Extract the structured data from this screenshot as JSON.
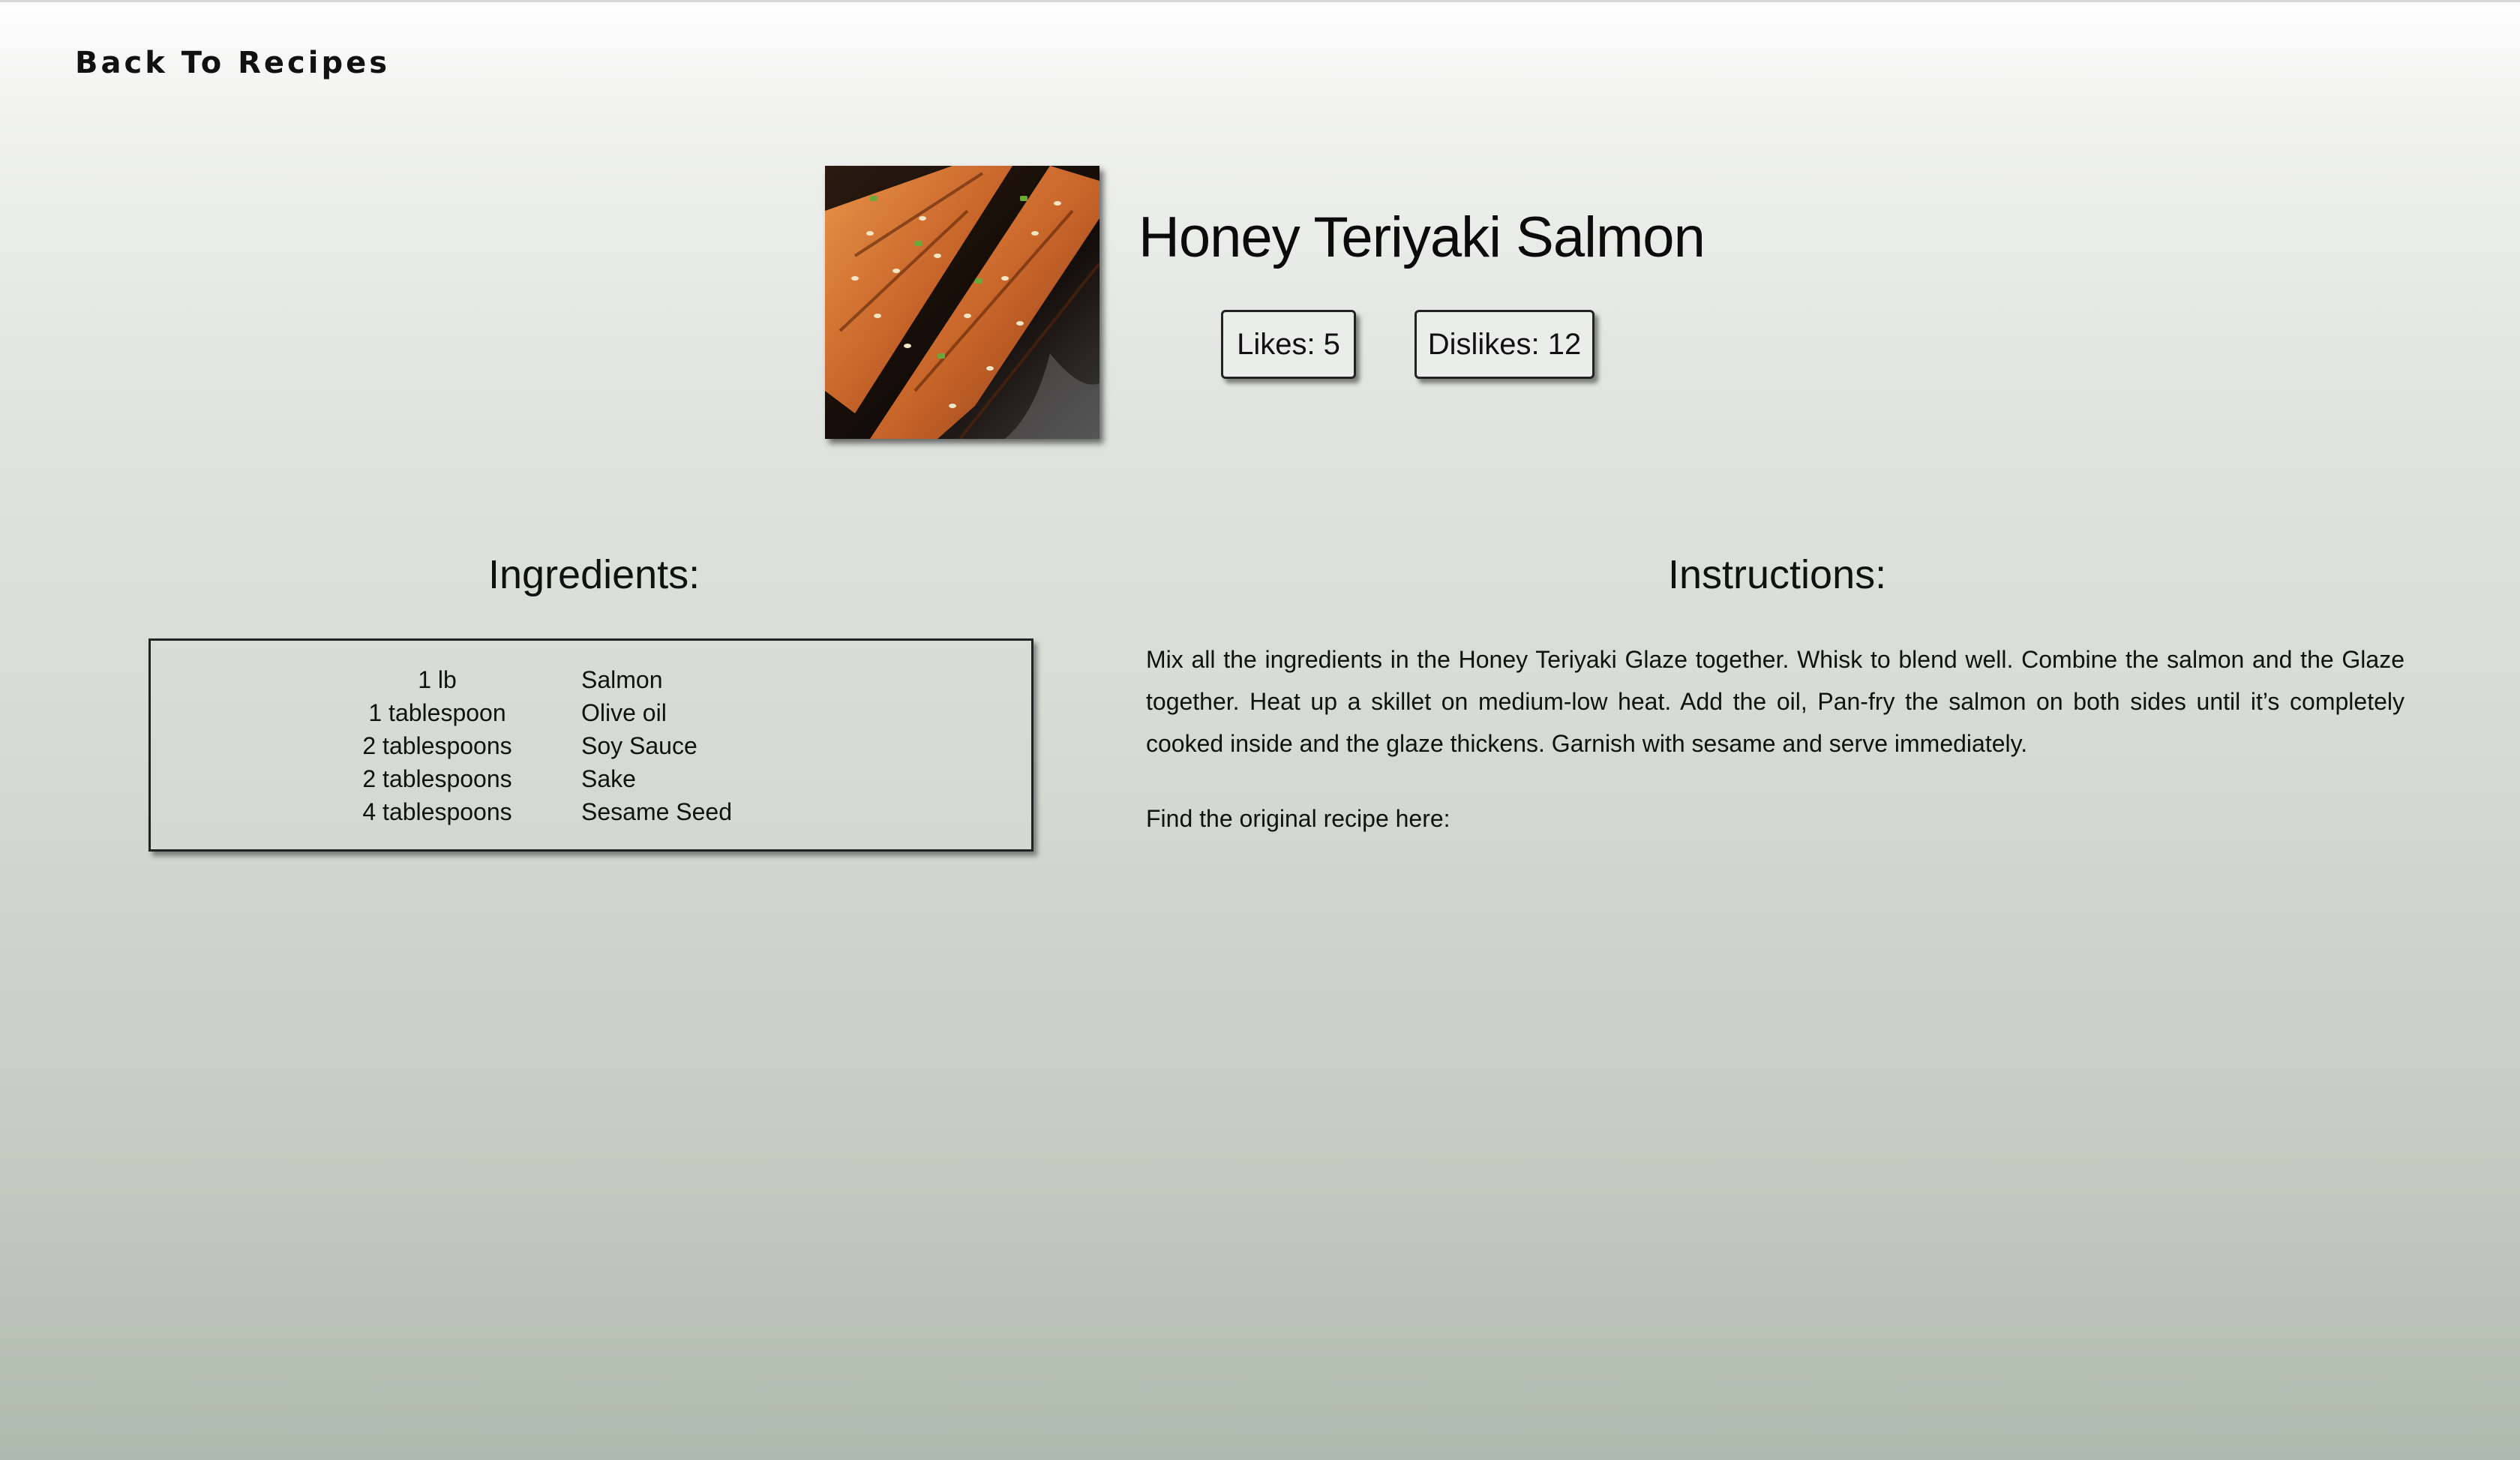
{
  "nav": {
    "back_label": "Back To Recipes"
  },
  "recipe": {
    "title": "Honey Teriyaki Salmon",
    "image_alt": "Honey teriyaki salmon fillets with sesame seeds in a skillet",
    "likes_label": "Likes: 5",
    "dislikes_label": "Dislikes: 12",
    "likes": 5,
    "dislikes": 12
  },
  "ingredients": {
    "heading": "Ingredients:",
    "items": [
      {
        "qty": "1 lb",
        "name": "Salmon"
      },
      {
        "qty": "1 tablespoon",
        "name": "Olive oil"
      },
      {
        "qty": "2 tablespoons",
        "name": "Soy Sauce"
      },
      {
        "qty": "2 tablespoons",
        "name": "Sake"
      },
      {
        "qty": "4 tablespoons",
        "name": "Sesame Seed"
      }
    ]
  },
  "instructions": {
    "heading": "Instructions:",
    "text": "Mix all the ingredients in the Honey Teriyaki Glaze together. Whisk to blend well. Combine the salmon and the Glaze together.  Heat up a skillet on medium-low heat. Add the oil, Pan-fry the salmon on both sides until it’s completely cooked inside and the glaze thickens.  Garnish with sesame and serve immediately.",
    "source_label": "Find the original recipe here:"
  },
  "colors": {
    "background_top": "#ffffff",
    "background_bottom": "#aebaad",
    "text": "#111111",
    "button_bg": "#ebedea"
  }
}
